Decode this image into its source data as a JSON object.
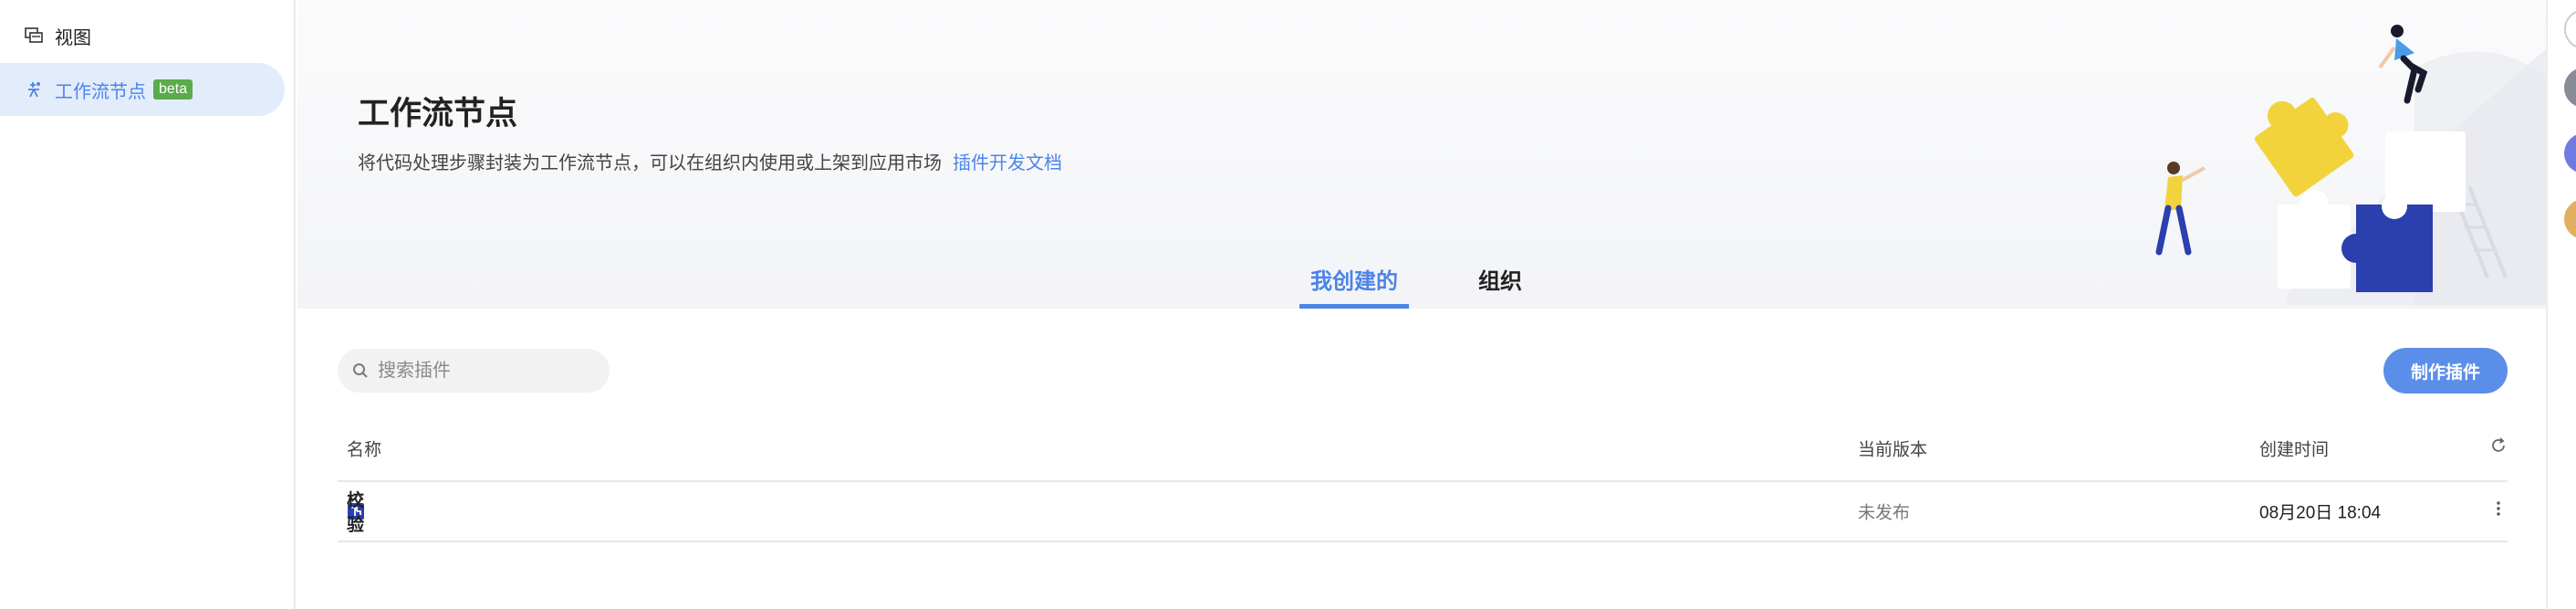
{
  "sidebar": {
    "items": [
      {
        "label": "视图",
        "icon": "view-icon"
      },
      {
        "label": "工作流节点",
        "icon": "workflow-node-icon",
        "badge": "beta",
        "active": true
      }
    ]
  },
  "hero": {
    "title": "工作流节点",
    "description": "将代码处理步骤封装为工作流节点，可以在组织内使用或上架到应用市场",
    "doc_link": "插件开发文档"
  },
  "tabs": [
    {
      "label": "我创建的",
      "active": true
    },
    {
      "label": "组织",
      "active": false
    }
  ],
  "search": {
    "placeholder": "搜索插件",
    "value": ""
  },
  "toolbar": {
    "create_label": "制作插件"
  },
  "table": {
    "headers": {
      "name": "名称",
      "version": "当前版本",
      "created": "创建时间"
    },
    "rows": [
      {
        "name": "校验",
        "version": "未发布",
        "created": "08月20日 18:04"
      }
    ]
  },
  "colors": {
    "accent": "#4b84e8",
    "beta": "#5aab4c",
    "button": "#5b8ee8"
  }
}
